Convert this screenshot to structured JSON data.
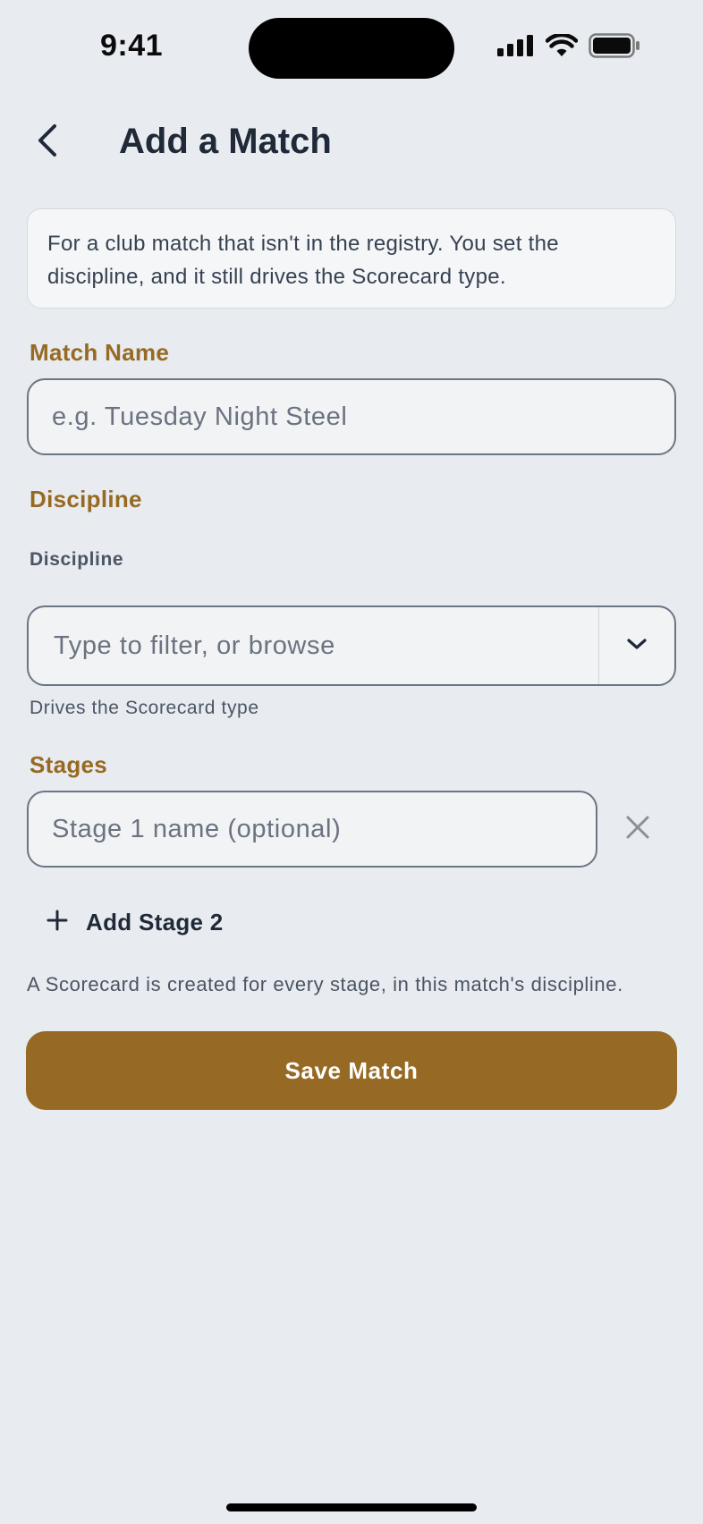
{
  "status_bar": {
    "time": "9:41"
  },
  "header": {
    "title": "Add a Match"
  },
  "info": {
    "text": "For a club match that isn't in the registry. You set the discipline, and it still drives the Scorecard type."
  },
  "match_name": {
    "label": "Match Name",
    "placeholder": "e.g. Tuesday Night Steel"
  },
  "discipline": {
    "section_label": "Discipline",
    "field_label": "Discipline",
    "placeholder": "Type to filter, or browse",
    "helper": "Drives the Scorecard type"
  },
  "stages": {
    "label": "Stages",
    "stage_placeholder": "Stage 1 name (optional)",
    "add_label": "Add Stage 2"
  },
  "footnote": "A Scorecard is created for every stage, in this match's discipline.",
  "save_label": "Save Match",
  "colors": {
    "accent": "#966a24",
    "background": "#e8ebef",
    "text": "#1f2937"
  }
}
